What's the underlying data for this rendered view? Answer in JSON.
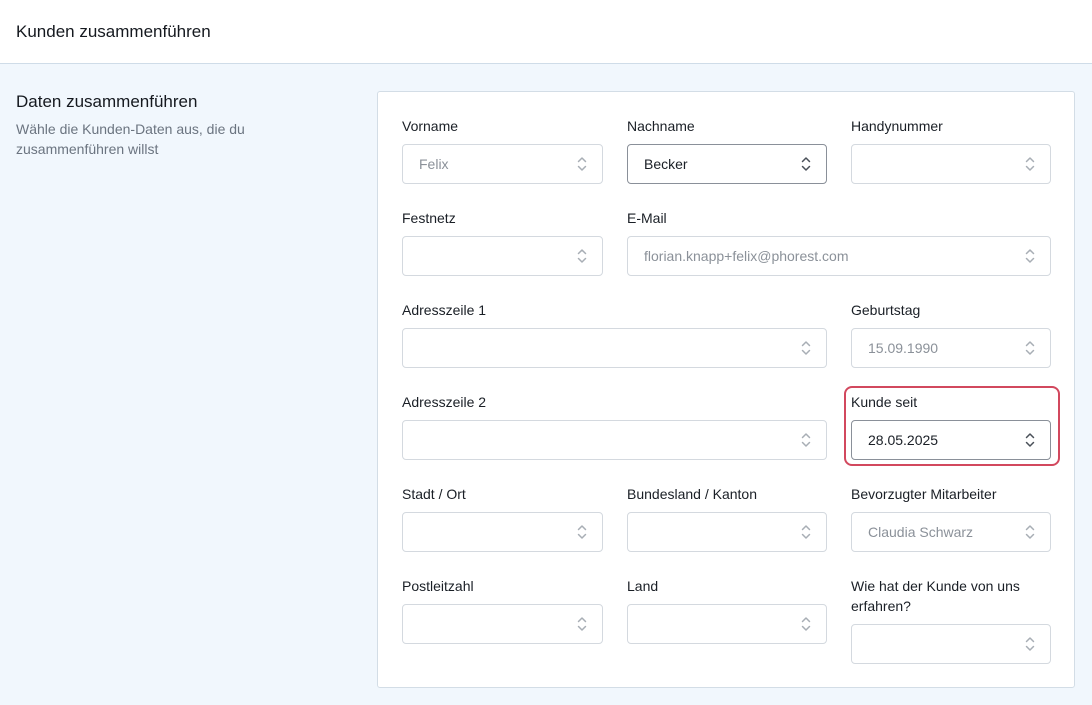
{
  "header": {
    "title": "Kunden zusammenführen"
  },
  "section": {
    "title": "Daten zusammenführen",
    "description": "Wähle die Kunden-Daten aus, die du zusammenführen willst"
  },
  "fields": {
    "vorname": {
      "label": "Vorname",
      "value": "Felix"
    },
    "nachname": {
      "label": "Nachname",
      "value": "Becker"
    },
    "handy": {
      "label": "Handynummer",
      "value": ""
    },
    "festnetz": {
      "label": "Festnetz",
      "value": ""
    },
    "email": {
      "label": "E-Mail",
      "value": "florian.knapp+felix@phorest.com"
    },
    "adresse1": {
      "label": "Adresszeile 1",
      "value": ""
    },
    "geburtstag": {
      "label": "Geburtstag",
      "value": "15.09.1990"
    },
    "adresse2": {
      "label": "Adresszeile 2",
      "value": ""
    },
    "kundeseit": {
      "label": "Kunde seit",
      "value": "28.05.2025"
    },
    "stadt": {
      "label": "Stadt / Ort",
      "value": ""
    },
    "bundesland": {
      "label": "Bundesland / Kanton",
      "value": ""
    },
    "mitarbeiter": {
      "label": "Bevorzugter Mitarbeiter",
      "value": "Claudia Schwarz"
    },
    "plz": {
      "label": "Postleitzahl",
      "value": ""
    },
    "land": {
      "label": "Land",
      "value": ""
    },
    "quelle": {
      "label_line1": "Wie hat der Kunde von uns",
      "label_line2": "erfahren?",
      "value": ""
    }
  },
  "icons": {
    "select_chevron": "chevron-up-down-icon"
  },
  "colors": {
    "highlight": "#d2485e",
    "background": "#f1f7fd"
  }
}
